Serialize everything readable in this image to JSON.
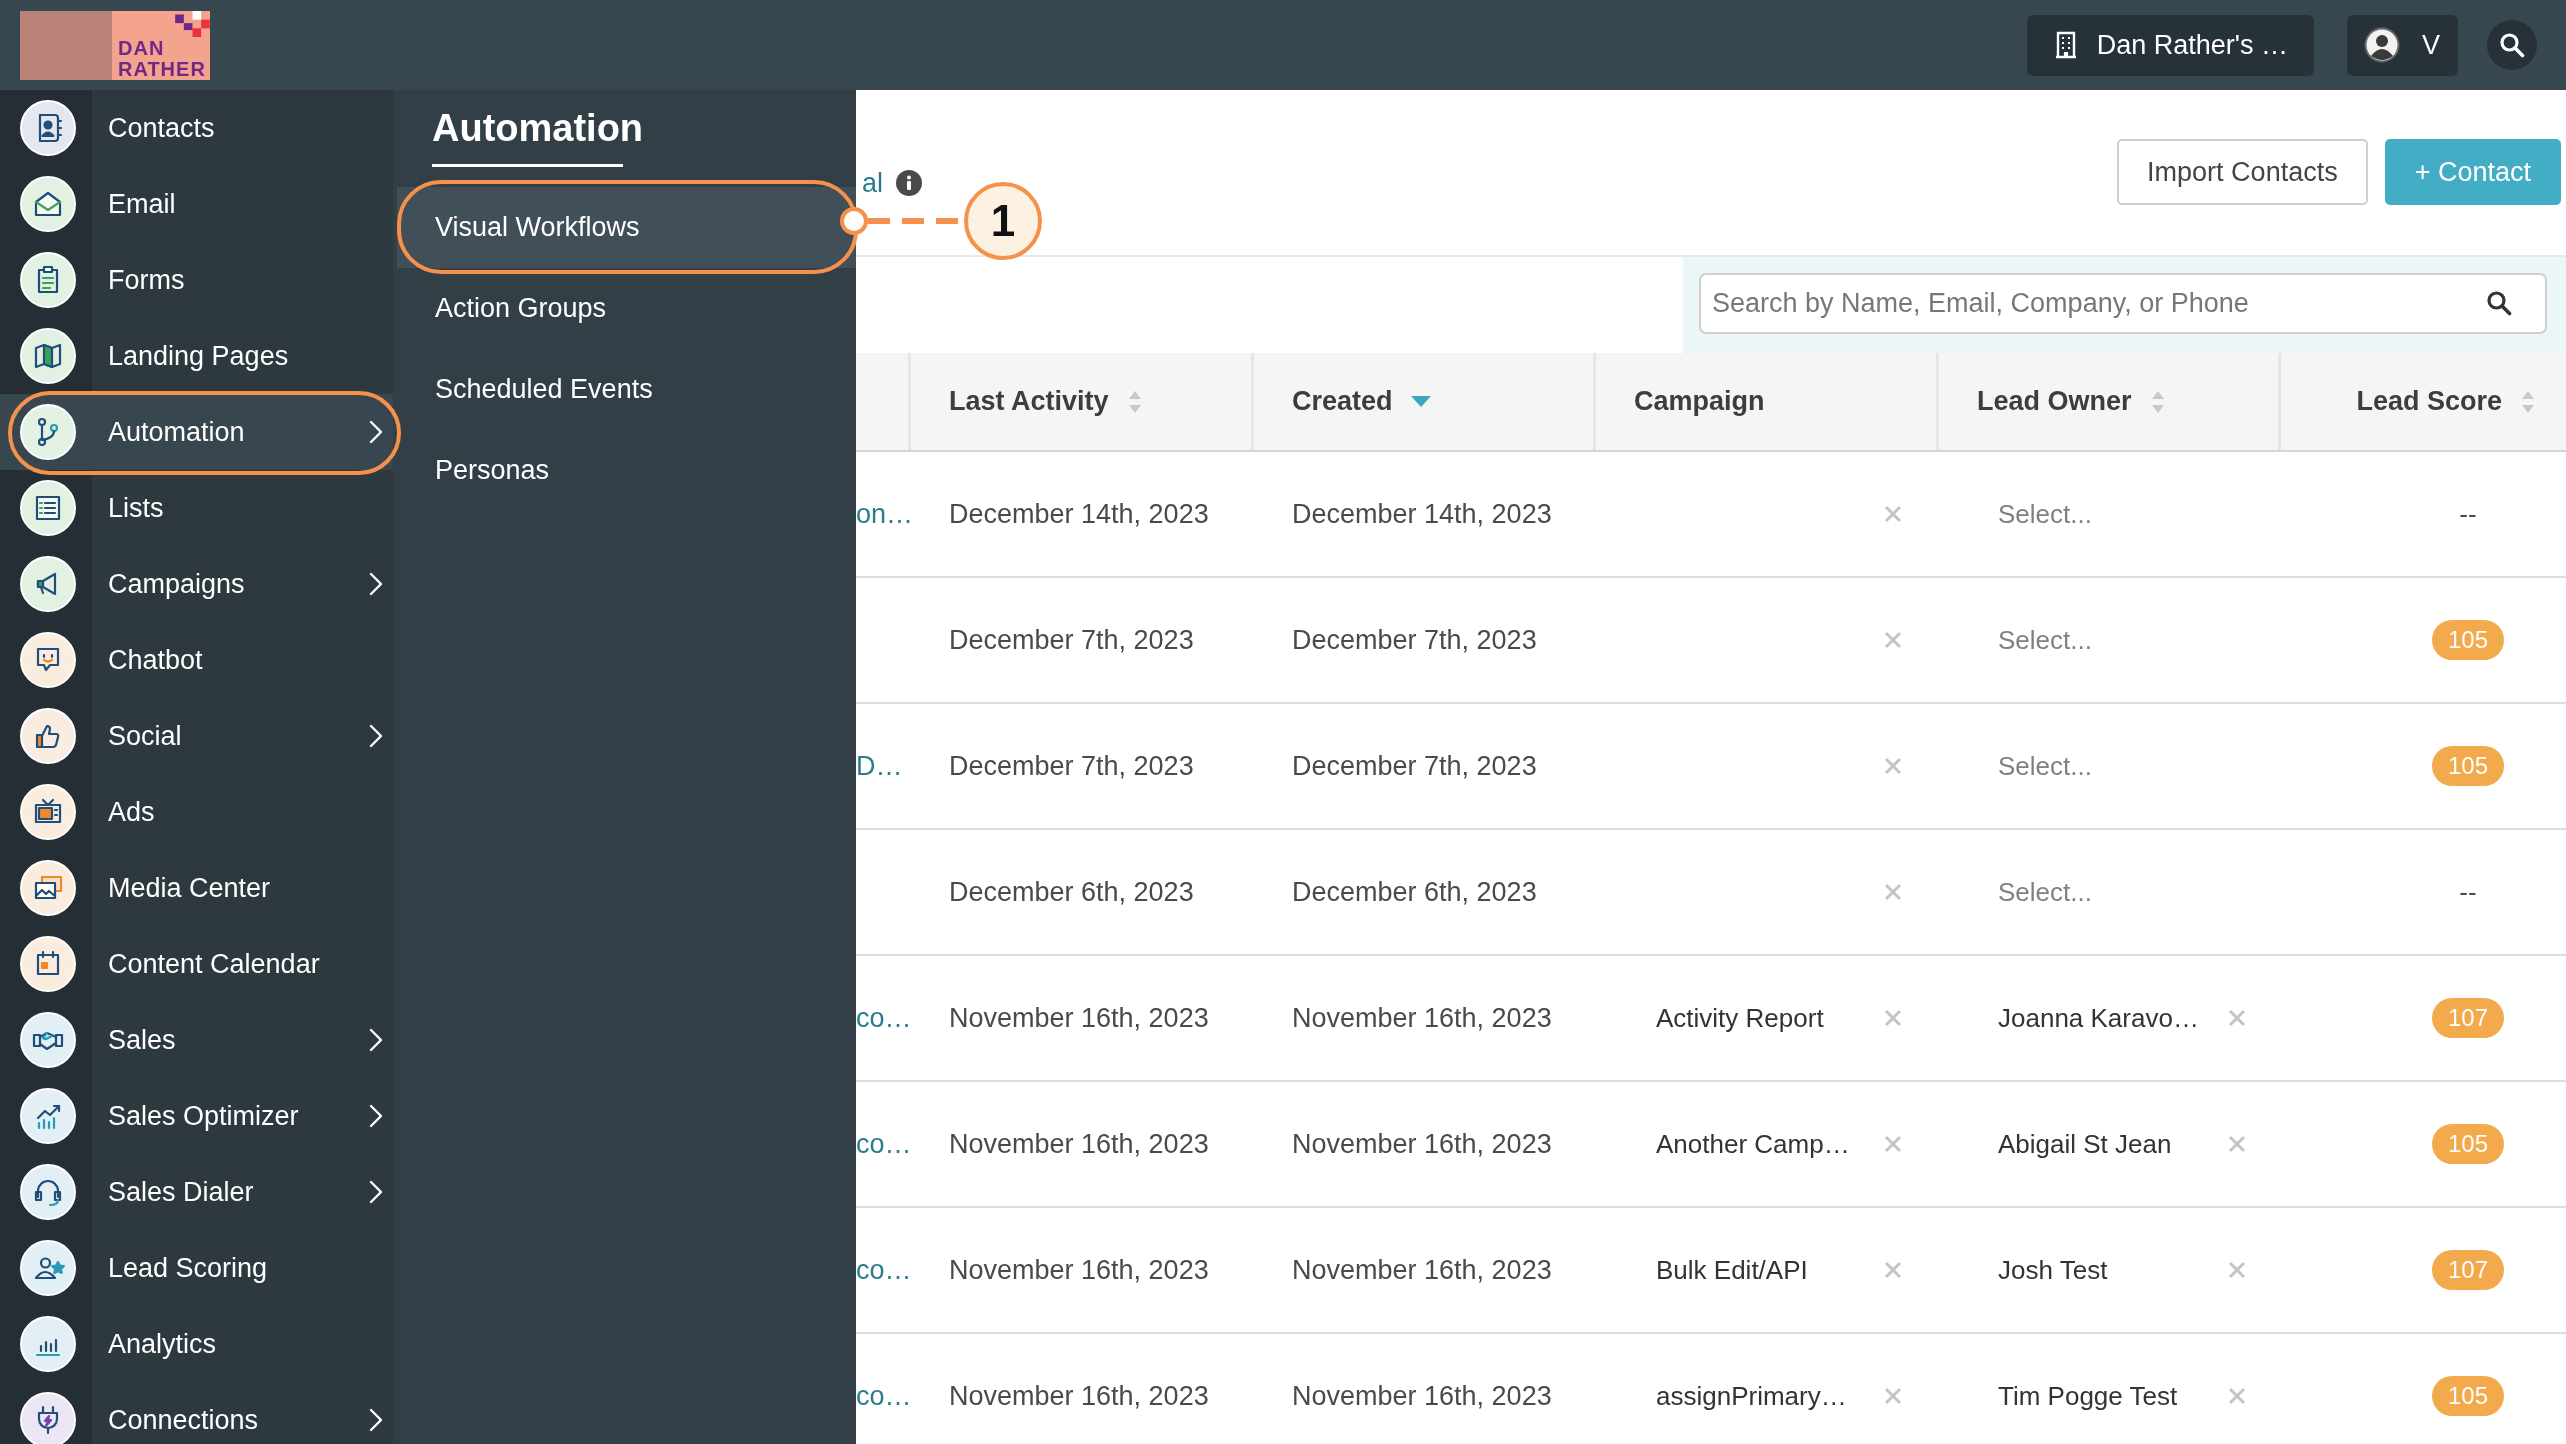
{
  "top_bar": {
    "logo": {
      "lines": [
        "DAN",
        "RATHER"
      ]
    },
    "account_button": "Dan Rather's …",
    "user_button": "V"
  },
  "sidebar": {
    "items": [
      {
        "label": "Contacts",
        "selected": false,
        "has_submenu": false,
        "highlighted": false
      },
      {
        "label": "Email",
        "selected": false,
        "has_submenu": false,
        "highlighted": false
      },
      {
        "label": "Forms",
        "selected": false,
        "has_submenu": false,
        "highlighted": false
      },
      {
        "label": "Landing Pages",
        "selected": false,
        "has_submenu": false,
        "highlighted": false
      },
      {
        "label": "Automation",
        "selected": true,
        "has_submenu": true,
        "highlighted": true
      },
      {
        "label": "Lists",
        "selected": false,
        "has_submenu": false,
        "highlighted": false
      },
      {
        "label": "Campaigns",
        "selected": false,
        "has_submenu": true,
        "highlighted": false
      },
      {
        "label": "Chatbot",
        "selected": false,
        "has_submenu": false,
        "highlighted": false
      },
      {
        "label": "Social",
        "selected": false,
        "has_submenu": true,
        "highlighted": false
      },
      {
        "label": "Ads",
        "selected": false,
        "has_submenu": false,
        "highlighted": false
      },
      {
        "label": "Media Center",
        "selected": false,
        "has_submenu": false,
        "highlighted": false
      },
      {
        "label": "Content Calendar",
        "selected": false,
        "has_submenu": false,
        "highlighted": false
      },
      {
        "label": "Sales",
        "selected": false,
        "has_submenu": true,
        "highlighted": false
      },
      {
        "label": "Sales Optimizer",
        "selected": false,
        "has_submenu": true,
        "highlighted": false
      },
      {
        "label": "Sales Dialer",
        "selected": false,
        "has_submenu": true,
        "highlighted": false
      },
      {
        "label": "Lead Scoring",
        "selected": false,
        "has_submenu": false,
        "highlighted": false
      },
      {
        "label": "Analytics",
        "selected": false,
        "has_submenu": false,
        "highlighted": false
      },
      {
        "label": "Connections",
        "selected": false,
        "has_submenu": true,
        "highlighted": false
      }
    ]
  },
  "submenu": {
    "title": "Automation",
    "items": [
      {
        "label": "Visual Workflows",
        "selected": true,
        "highlighted": true,
        "callout": "1"
      },
      {
        "label": "Action Groups",
        "selected": false,
        "highlighted": false
      },
      {
        "label": "Scheduled Events",
        "selected": false,
        "highlighted": false
      },
      {
        "label": "Personas",
        "selected": false,
        "highlighted": false
      }
    ]
  },
  "page_header": {
    "link": "al",
    "buttons": [
      {
        "label": "Import Contacts",
        "kind": "secondary"
      },
      {
        "label": "+ Contact",
        "kind": "primary"
      }
    ]
  },
  "search": {
    "placeholder": "Search by Name, Email, Company, or Phone"
  },
  "table": {
    "columns": [
      {
        "label": "Last Activity",
        "sortable": true,
        "sorted": false
      },
      {
        "label": "Created",
        "sortable": true,
        "sorted": true
      },
      {
        "label": "Campaign",
        "sortable": false,
        "sorted": false
      },
      {
        "label": "Lead Owner",
        "sortable": true,
        "sorted": false
      },
      {
        "label": "Lead Score",
        "sortable": true,
        "sorted": false
      }
    ],
    "rows": [
      {
        "column_1": "on…",
        "last_activity": "December 14th, 2023",
        "created": "December 14th, 2023",
        "lead_owner": {
          "placeholder": "Select..."
        },
        "lead_score": {
          "kind": "empty",
          "text": "--"
        }
      },
      {
        "last_activity": "December 7th, 2023",
        "created": "December 7th, 2023",
        "lead_owner": {
          "placeholder": "Select..."
        },
        "lead_score": {
          "kind": "badge",
          "text": "105"
        }
      },
      {
        "column_1": "D…",
        "last_activity": "December 7th, 2023",
        "created": "December 7th, 2023",
        "lead_owner": {
          "placeholder": "Select..."
        },
        "lead_score": {
          "kind": "badge",
          "text": "105"
        }
      },
      {
        "last_activity": "December 6th, 2023",
        "created": "December 6th, 2023",
        "lead_owner": {
          "placeholder": "Select..."
        },
        "lead_score": {
          "kind": "empty",
          "text": "--"
        }
      },
      {
        "column_1": "co…",
        "last_activity": "November 16th, 2023",
        "created": "November 16th, 2023",
        "campaign": "Activity Report",
        "lead_owner": {
          "value": "Joanna Karavo…"
        },
        "lead_score": {
          "kind": "badge",
          "text": "107"
        }
      },
      {
        "column_1": "co…",
        "last_activity": "November 16th, 2023",
        "created": "November 16th, 2023",
        "campaign": "Another Camp…",
        "lead_owner": {
          "value": "Abigail St Jean"
        },
        "lead_score": {
          "kind": "badge",
          "text": "105"
        }
      },
      {
        "column_1": "co…",
        "last_activity": "November 16th, 2023",
        "created": "November 16th, 2023",
        "campaign": "Bulk Edit/API",
        "lead_owner": {
          "value": "Josh Test"
        },
        "lead_score": {
          "kind": "badge",
          "text": "107"
        }
      },
      {
        "column_1": "co…",
        "last_activity": "November 16th, 2023",
        "created": "November 16th, 2023",
        "campaign": "assignPrimary…",
        "lead_owner": {
          "value": "Tim Pogge Test"
        },
        "lead_score": {
          "kind": "badge",
          "text": "105"
        }
      }
    ]
  }
}
